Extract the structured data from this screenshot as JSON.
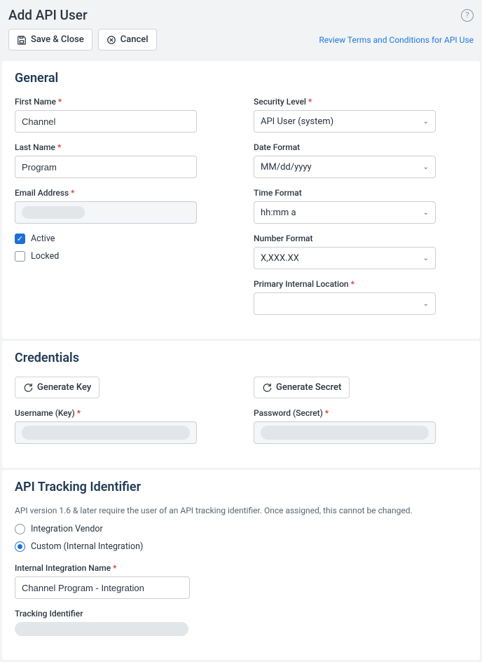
{
  "header": {
    "title": "Add API User",
    "save_close": "Save & Close",
    "cancel": "Cancel",
    "terms_link": "Review Terms and Conditions for API Use"
  },
  "general": {
    "title": "General",
    "first_name_label": "First Name",
    "first_name_value": "Channel",
    "last_name_label": "Last Name",
    "last_name_value": "Program",
    "email_label": "Email Address",
    "active_label": "Active",
    "active_checked": true,
    "locked_label": "Locked",
    "locked_checked": false,
    "security_level_label": "Security Level",
    "security_level_value": "API User (system)",
    "date_format_label": "Date Format",
    "date_format_value": "MM/dd/yyyy",
    "time_format_label": "Time Format",
    "time_format_value": "hh:mm a",
    "number_format_label": "Number Format",
    "number_format_value": "X,XXX.XX",
    "primary_location_label": "Primary Internal Location",
    "primary_location_value": ""
  },
  "credentials": {
    "title": "Credentials",
    "gen_key": "Generate Key",
    "gen_secret": "Generate Secret",
    "username_label": "Username (Key)",
    "password_label": "Password (Secret)"
  },
  "tracking": {
    "title": "API Tracking Identifier",
    "desc": "API version 1.6 & later require the user of an API tracking identifier. Once assigned, this cannot be changed.",
    "vendor_label": "Integration Vendor",
    "vendor_selected": false,
    "custom_label": "Custom (Internal Integration)",
    "custom_selected": true,
    "internal_name_label": "Internal Integration Name",
    "internal_name_value": "Channel Program - Integration",
    "tracking_id_label": "Tracking Identifier"
  }
}
